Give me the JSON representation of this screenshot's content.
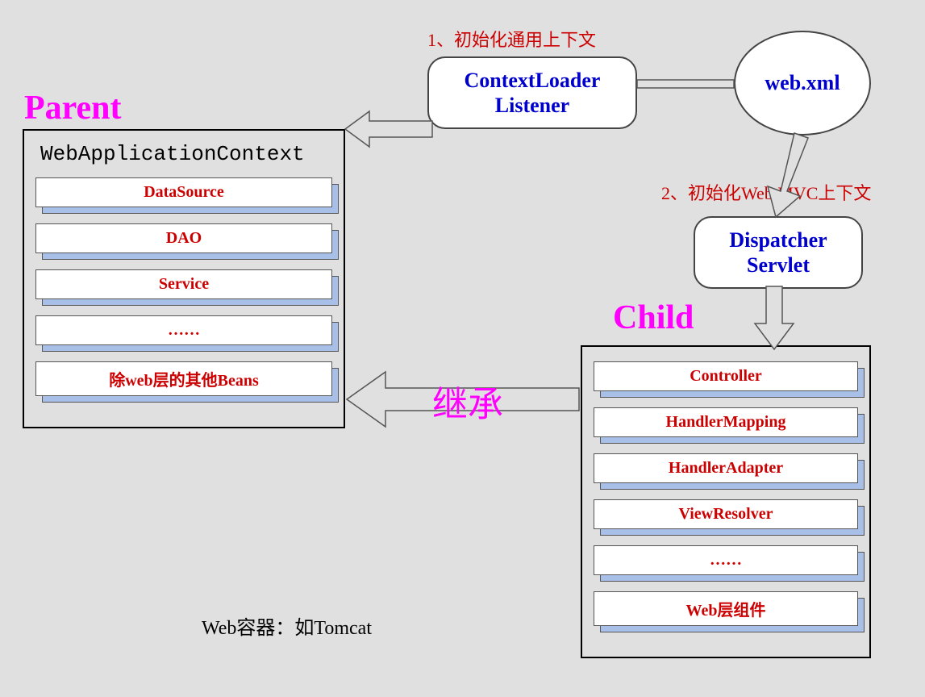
{
  "titles": {
    "parent": "Parent",
    "child": "Child"
  },
  "parentBox": {
    "header": "WebApplicationContext",
    "items": [
      "DataSource",
      "DAO",
      "Service",
      "……",
      "除web层的其他Beans"
    ]
  },
  "childBox": {
    "items": [
      "Controller",
      "HandlerMapping",
      "HandlerAdapter",
      "ViewResolver",
      "……",
      "Web层组件"
    ]
  },
  "nodes": {
    "contextLoaderListener_l1": "ContextLoader",
    "contextLoaderListener_l2": "Listener",
    "webxml": "web.xml",
    "dispatcherServlet_l1": "Dispatcher",
    "dispatcherServlet_l2": "Servlet"
  },
  "steps": {
    "step1": "1、初始化通用上下文",
    "step2": "2、初始化Web MVC上下文"
  },
  "inherit": "继承",
  "footer": "Web容器：如Tomcat"
}
